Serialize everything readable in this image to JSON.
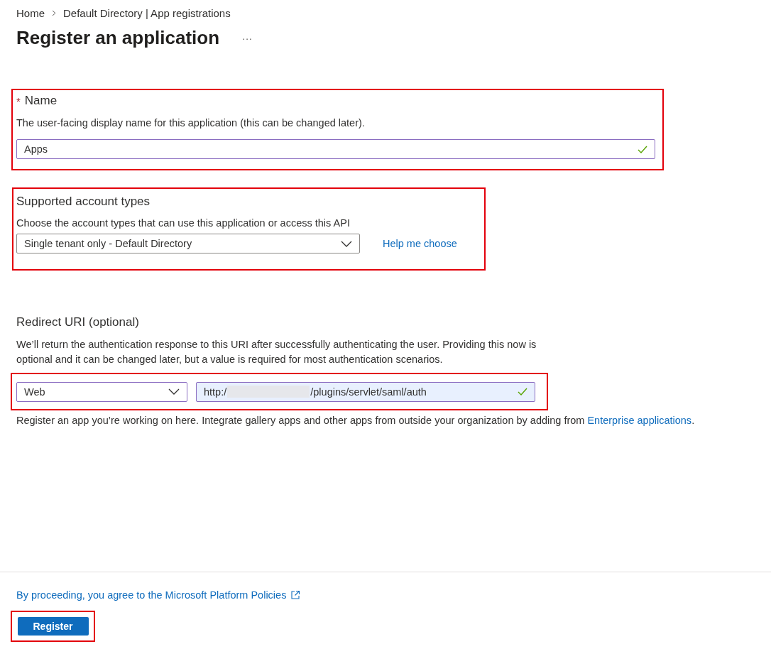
{
  "breadcrumb": [
    {
      "label": "Home"
    },
    {
      "label": "Default Directory | App registrations"
    }
  ],
  "title": "Register an application",
  "more_button": "···",
  "name_section": {
    "highlighted": true,
    "required_mark": "*",
    "label": "Name",
    "description": "The user-facing display name for this application (this can be changed later).",
    "field": {
      "value": "Apps",
      "valid": true
    }
  },
  "account_types": {
    "highlighted": true,
    "label": "Supported account types",
    "description": "Choose the account types that can use this application or access this API",
    "dropdown": {
      "value": "Single tenant only - Default Directory"
    },
    "help_link": "Help me choose"
  },
  "redirect_uri": {
    "label": "Redirect URI (optional)",
    "description": "We’ll return the authentication response to this URI after successfully authenticating the user. Providing this now is optional and it can be changed later, but a value is required for most authentication scenarios.",
    "highlighted": true,
    "platform_dropdown": {
      "value": "Web"
    },
    "uri_field": {
      "value_start": "http:/",
      "redacted": true,
      "value_end": "/plugins/servlet/saml/auth",
      "autofilled": true,
      "valid": true
    },
    "note": "Register an app you’re working on here. Integrate gallery apps and other apps from outside your organization by adding from ",
    "note_link": "Enterprise applications",
    "note_end": "."
  },
  "footer": {
    "policy_link": "By proceeding, you agree to the Microsoft Platform Policies",
    "register_button": {
      "label": "Register",
      "highlighted": true
    }
  }
}
